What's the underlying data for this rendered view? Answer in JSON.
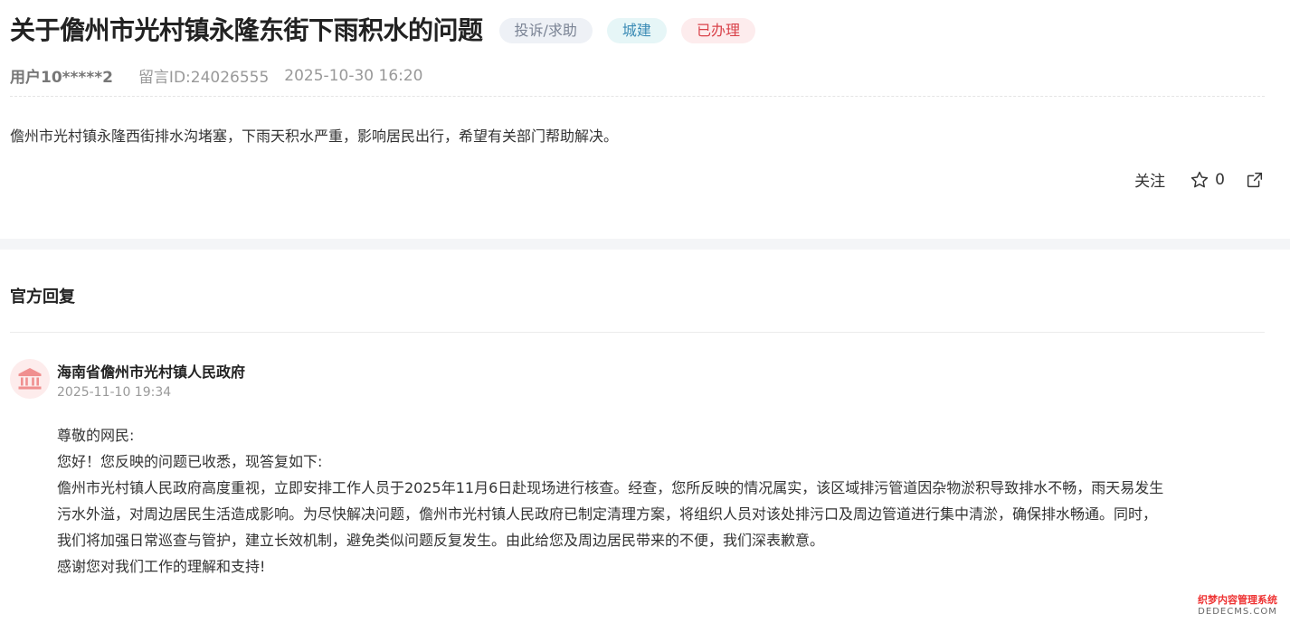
{
  "post": {
    "title": "关于儋州市光村镇永隆东街下雨积水的问题",
    "tags": {
      "type": "投诉/求助",
      "domain": "城建",
      "status": "已办理"
    },
    "user": "用户10*****2",
    "message_id": "留言ID:24026555",
    "time": "2025-10-30 16:20",
    "content": "儋州市光村镇永隆西街排水沟堵塞，下雨天积水严重，影响居民出行，希望有关部门帮助解决。",
    "actions": {
      "follow_label": "关注",
      "favorite_count": "0",
      "favorite_icon": "star-icon",
      "share_icon": "share-icon"
    }
  },
  "reply": {
    "heading": "官方回复",
    "org_name": "海南省儋州市光村镇人民政府",
    "org_icon": "government-building-icon",
    "time": "2025-11-10 19:34",
    "lines": [
      "尊敬的网民:",
      "您好！您反映的问题已收悉，现答复如下:",
      "儋州市光村镇人民政府高度重视，立即安排工作人员于2025年11月6日赴现场进行核查。经查，您所反映的情况属实，该区域排污管道因杂物淤积导致排水不畅，雨天易发生",
      "污水外溢，对周边居民生活造成影响。为尽快解决问题，儋州市光村镇人民政府已制定清理方案，将组织人员对该处排污口及周边管道进行集中清淤，确保排水畅通。同时，",
      "我们将加强日常巡查与管护，建立长效机制，避免类似问题反复发生。由此给您及周边居民带来的不便，我们深表歉意。",
      "感谢您对我们工作的理解和支持!"
    ]
  },
  "watermark": {
    "line1": "织梦内容管理系统",
    "line2": "DEDECMS.COM"
  },
  "colors": {
    "status_tag": "#d9424a",
    "domain_tag": "#3b8bb5",
    "type_tag": "#7a8394"
  }
}
